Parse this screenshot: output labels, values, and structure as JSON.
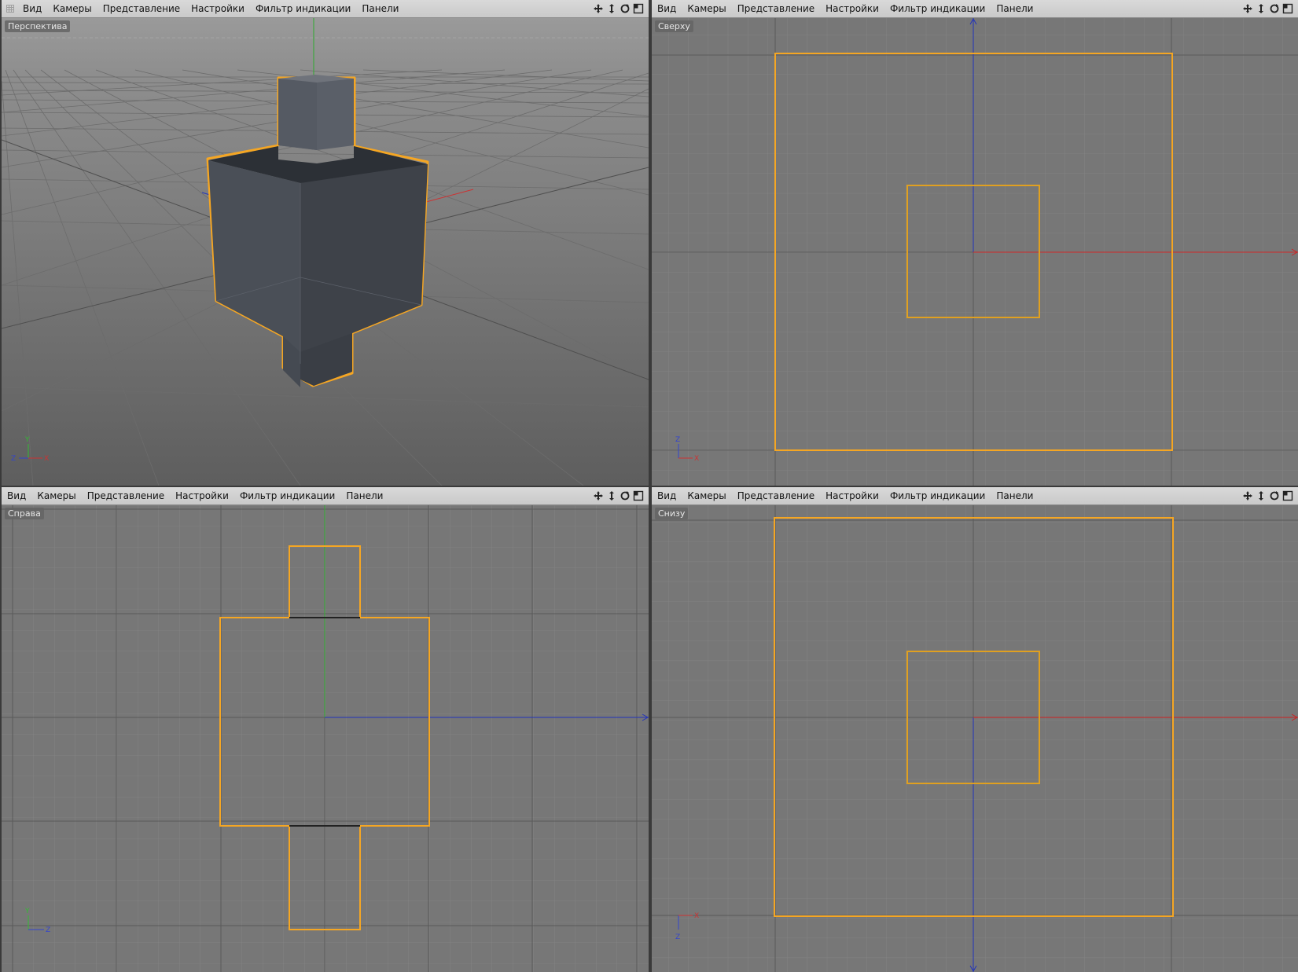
{
  "menu": {
    "view": "Вид",
    "cameras": "Камеры",
    "display": "Представление",
    "settings": "Настройки",
    "filter": "Фильтр индикации",
    "panels": "Панели"
  },
  "viewports": {
    "perspective": {
      "label": "Перспектива"
    },
    "top": {
      "label": "Сверху"
    },
    "right": {
      "label": "Справа"
    },
    "bottom": {
      "label": "Снизу"
    }
  },
  "axes": {
    "x_label": "X",
    "y_label": "Y",
    "z_label": "Z"
  },
  "colors": {
    "selection": "#f5a623",
    "axis_x": "#cc2222",
    "axis_y": "#22aa22",
    "axis_z": "#2233bb",
    "grid_bg": "#777777",
    "object": "#4a4e55"
  },
  "icons": [
    "move-icon",
    "scale-icon",
    "rotate-icon",
    "maximize-icon"
  ]
}
